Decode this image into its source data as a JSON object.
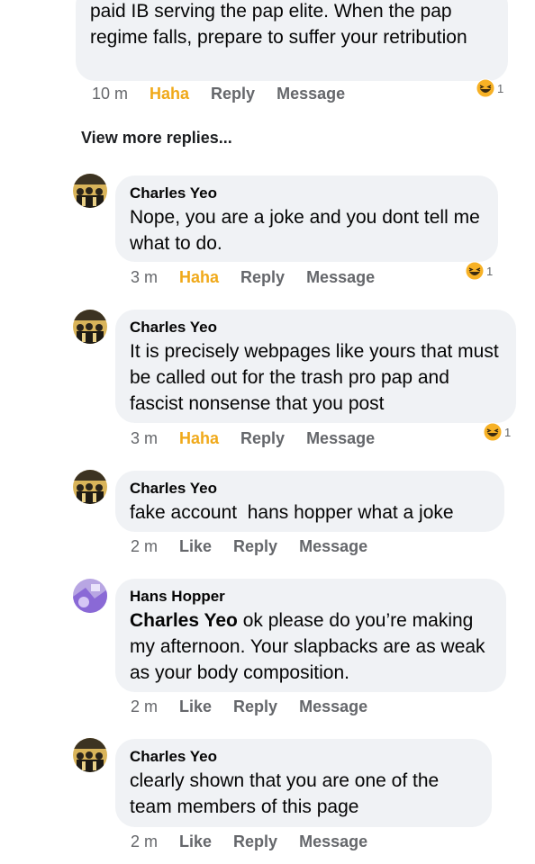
{
  "comments": [
    {
      "author": "",
      "text": "paid IB serving the pap elite. When the pap regime falls, prepare to suffer your retribution",
      "time": "10 m",
      "reaction_label": "Haha",
      "reply": "Reply",
      "message": "Message",
      "reaction_count": "1"
    },
    {
      "author": "Charles Yeo",
      "text": "Nope, you are a joke and you dont tell me what to do.",
      "time": "3 m",
      "reaction_label": "Haha",
      "reply": "Reply",
      "message": "Message",
      "reaction_count": "1"
    },
    {
      "author": "Charles Yeo",
      "text": "It is precisely webpages like yours that must be called out for the trash pro pap and fascist nonsense that you post",
      "time": "3 m",
      "reaction_label": "Haha",
      "reply": "Reply",
      "message": "Message",
      "reaction_count": "1"
    },
    {
      "author": "Charles Yeo",
      "text": "fake account  hans hopper what a joke",
      "time": "2 m",
      "reaction_label": "Like",
      "reply": "Reply",
      "message": "Message"
    },
    {
      "author": "Hans Hopper",
      "mention": "Charles Yeo",
      "text": " ok please do you’re making my afternoon. Your slapbacks are as weak as your body composition.",
      "time": "2 m",
      "reaction_label": "Like",
      "reply": "Reply",
      "message": "Message"
    },
    {
      "author": "Charles Yeo",
      "text": "clearly shown that you are one of the team members of this page",
      "time": "2 m",
      "reaction_label": "Like",
      "reply": "Reply",
      "message": "Message"
    }
  ],
  "view_more": "View more replies...",
  "colors": {
    "bubble": "#f0f2f5",
    "action": "#65676b",
    "haha": "#f0a91a",
    "text": "#050505"
  },
  "icons": {
    "reaction": "haha-emoji-icon",
    "avatar_charles": "group-photo-avatar",
    "avatar_hans": "purple-abstract-avatar"
  }
}
